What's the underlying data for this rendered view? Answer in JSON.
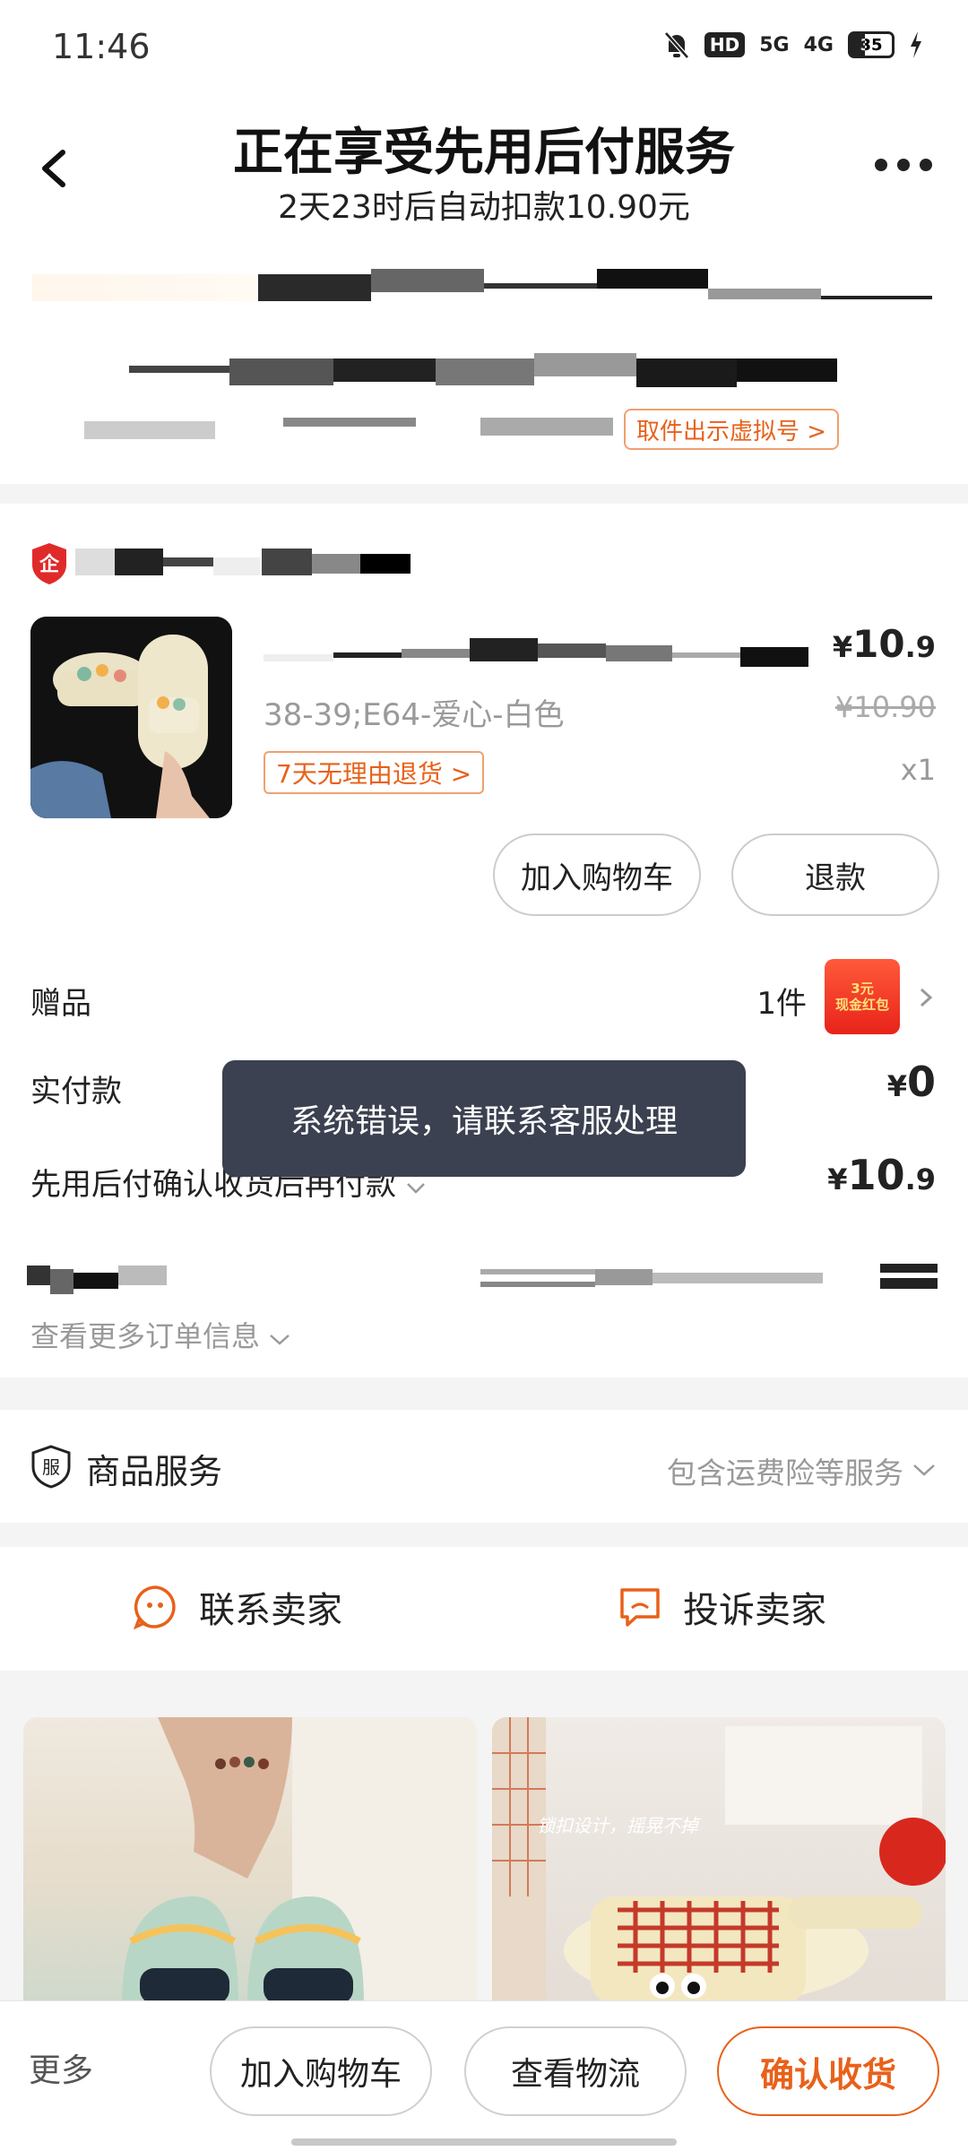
{
  "status_bar": {
    "time": "11:46",
    "hd": "HD",
    "net1": "5G",
    "net2": "4G",
    "battery": "35"
  },
  "header": {
    "title": "正在享受先用后付服务",
    "subtitle": "2天23时后自动扣款10.90元",
    "virtual_number_button": "取件出示虚拟号 >"
  },
  "shop": {
    "logo_char": "企"
  },
  "product": {
    "variant": "38-39;E64-爱心-白色",
    "return_tag": "7天无理由退货 >",
    "price_symbol": "¥",
    "price_int": "10",
    "price_dec": ".9",
    "original_price": "¥10.90",
    "quantity": "x1",
    "add_to_cart_button": "加入购物车",
    "refund_button": "退款"
  },
  "summary": {
    "gift_label": "赠品",
    "gift_count": "1件",
    "gift_badge_line1": "3元",
    "gift_badge_line2": "现金红包",
    "paid_label": "实付款",
    "paid_symbol": "¥",
    "paid_value": "0",
    "bnpl_label": "先用后付确认收货后再付款",
    "bnpl_symbol": "¥",
    "bnpl_int": "10",
    "bnpl_dec": ".9",
    "more_info": "查看更多订单信息"
  },
  "toast": {
    "message": "系统错误，请联系客服处理"
  },
  "service": {
    "icon_char": "服",
    "title": "商品服务",
    "value": "包含运费险等服务"
  },
  "contact": {
    "seller": "联系卖家",
    "complain": "投诉卖家"
  },
  "recommend": {
    "caption_b": "锁扣设计，摇晃不掉"
  },
  "bottom_bar": {
    "more": "更多",
    "add_to_cart": "加入购物车",
    "view_logistics": "查看物流",
    "confirm_receipt": "确认收货"
  },
  "colors": {
    "accent": "#e8611a",
    "toast_bg": "#3b4150"
  }
}
